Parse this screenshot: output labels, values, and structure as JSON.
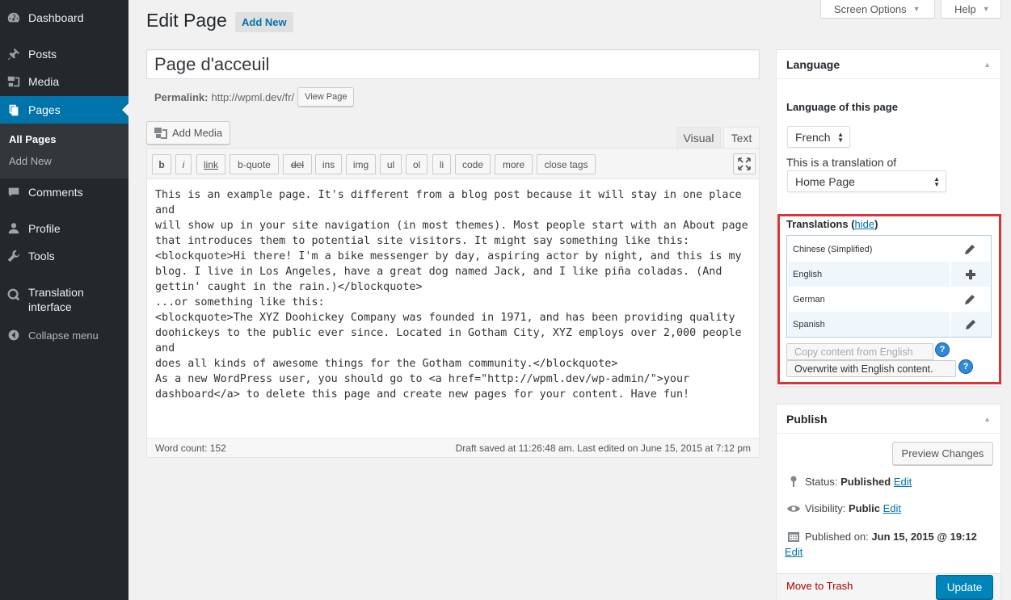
{
  "sidebar": {
    "items": [
      {
        "label": "Dashboard",
        "icon": "dashboard-icon"
      },
      {
        "label": "Posts",
        "icon": "pin-icon"
      },
      {
        "label": "Media",
        "icon": "media-icon"
      },
      {
        "label": "Pages",
        "icon": "pages-icon"
      },
      {
        "label": "Comments",
        "icon": "comment-icon"
      },
      {
        "label": "Profile",
        "icon": "user-icon"
      },
      {
        "label": "Tools",
        "icon": "wrench-icon"
      },
      {
        "label": "Translation interface",
        "icon": "translation-icon"
      },
      {
        "label": "Collapse menu",
        "icon": "collapse-icon"
      }
    ],
    "submenu": [
      "All Pages",
      "Add New"
    ]
  },
  "header": {
    "screen_options": "Screen Options",
    "help": "Help",
    "title": "Edit Page",
    "add_new": "Add New"
  },
  "post": {
    "title": "Page d'acceuil",
    "permalink_label": "Permalink:",
    "permalink_url": "http://wpml.dev/fr/",
    "view_page": "View Page"
  },
  "editor": {
    "add_media": "Add Media",
    "tabs": [
      "Visual",
      "Text"
    ],
    "quicktags": [
      "b",
      "i",
      "link",
      "b-quote",
      "del",
      "ins",
      "img",
      "ul",
      "ol",
      "li",
      "code",
      "more",
      "close tags"
    ],
    "content": "This is an example page. It's different from a blog post because it will stay in one place and\nwill show up in your site navigation (in most themes). Most people start with an About page\nthat introduces them to potential site visitors. It might say something like this:\n<blockquote>Hi there! I'm a bike messenger by day, aspiring actor by night, and this is my\nblog. I live in Los Angeles, have a great dog named Jack, and I like piña coladas. (And\ngettin' caught in the rain.)</blockquote>\n...or something like this:\n<blockquote>The XYZ Doohickey Company was founded in 1971, and has been providing quality\ndoohickeys to the public ever since. Located in Gotham City, XYZ employs over 2,000 people and\ndoes all kinds of awesome things for the Gotham community.</blockquote>\nAs a new WordPress user, you should go to <a href=\"http://wpml.dev/wp-admin/\">your\ndashboard</a> to delete this page and create new pages for your content. Have fun!",
    "word_count": "Word count: 152",
    "draft_status": "Draft saved at 11:26:48 am. Last edited on June 15, 2015 at 7:12 pm"
  },
  "language_box": {
    "title": "Language",
    "language_of_page_label": "Language of this page",
    "language_selected": "French",
    "translation_of_label": "This is a translation of",
    "translation_of_selected": "Home Page",
    "translations_label": "Translations",
    "hide_link": "hide",
    "translations": [
      {
        "language": "Chinese (Simplified)",
        "action_icon": "pencil-icon"
      },
      {
        "language": "English",
        "action_icon": "plus-icon"
      },
      {
        "language": "German",
        "action_icon": "pencil-icon"
      },
      {
        "language": "Spanish",
        "action_icon": "pencil-icon"
      }
    ],
    "copy_content": "Copy content from English",
    "overwrite": "Overwrite with English content.",
    "highlight_color": "#d63638"
  },
  "publish_box": {
    "title": "Publish",
    "preview": "Preview Changes",
    "status_label": "Status:",
    "status_value": "Published",
    "visibility_label": "Visibility:",
    "visibility_value": "Public",
    "published_label": "Published on:",
    "published_value": "Jun 15, 2015 @ 19:12",
    "edit": "Edit",
    "move_to_trash": "Move to Trash",
    "update": "Update"
  },
  "colors": {
    "accent": "#0073aa",
    "sidebar_bg": "#23282d",
    "primary_button": "#0085ba"
  }
}
